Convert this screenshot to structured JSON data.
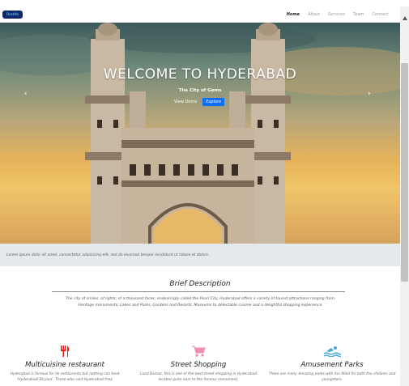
{
  "navbar": {
    "brand": "DestHb",
    "links": [
      "Home",
      "About",
      "Services",
      "Team",
      "Connect"
    ]
  },
  "hero": {
    "title": "WELCOME TO HYDERABAD",
    "subtitle": "The City of Gems",
    "button_demo": "View Demo",
    "button_explore": "Explore",
    "prev_icon": "‹",
    "next_icon": "›"
  },
  "caption": "Lorem ipsum dolor sit amet, consectetur adipisicing elit, sed do eiusmod tempor incididunt ut labore et dolore .",
  "description": {
    "title": "Brief Description",
    "text": "The city of smiles, of lights, of a thousand faces, endearingly called the Pearl City, Hyderabad offers a variety of tourist attractions ranging from Heritage monuments, Lakes and Parks, Gardens and Resorts, Museums to delectable cuisine and a delightful shopping experience"
  },
  "features": [
    {
      "icon": "restaurant-icon",
      "title": "Multicuisine restaurant",
      "text": "Hyderabad is famous for its restaurants but nothing can beat 'Hyderabadi Biryani'. Those who visit Hyderabad they",
      "color": "#e8201a"
    },
    {
      "icon": "shopping-cart-icon",
      "title": "Street Shopping",
      "text": "Laad Bazaar, this is one of the best street shopping in Hyderabad located quite near to the famous monument,",
      "color": "#f28db0"
    },
    {
      "icon": "swimmer-icon",
      "title": "Amusement Parks",
      "text": "There are many Amazing parks with fun filled for both the children and youngsters.",
      "color": "#4aa8d8"
    }
  ]
}
